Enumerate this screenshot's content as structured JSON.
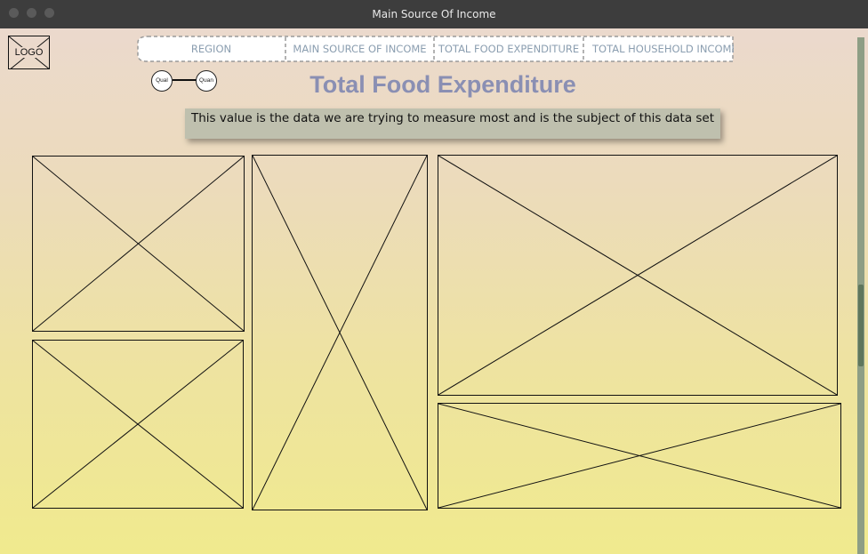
{
  "window": {
    "title": "Main Source Of Income"
  },
  "logo": {
    "label": "LOGO"
  },
  "nav": {
    "tabs": [
      {
        "label": "REGION"
      },
      {
        "label": "MAIN SOURCE OF INCOME"
      },
      {
        "label": "TOTAL FOOD EXPENDITURE"
      },
      {
        "label": "TOTAL HOUSEHOLD INCOME"
      }
    ]
  },
  "toggle": {
    "left_label": "Qual",
    "right_label": "Quan"
  },
  "page": {
    "title": "Total Food Expenditure",
    "description": "This value is the data we are trying to measure most and is the subject of this data set"
  },
  "colors": {
    "title": "#8a8fb3",
    "tab_text": "#8b9eb0",
    "description_bg": "#bfc0ae",
    "titlebar": "#3d3d3d"
  },
  "placeholders": {
    "icon": "image-placeholder-icon",
    "count": 6
  }
}
